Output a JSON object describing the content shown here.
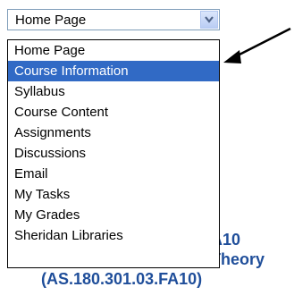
{
  "select": {
    "value": "Home Page",
    "options": [
      {
        "label": "Home Page"
      },
      {
        "label": "Course Information",
        "selected": true
      },
      {
        "label": "Syllabus"
      },
      {
        "label": "Course Content"
      },
      {
        "label": "Assignments"
      },
      {
        "label": "Discussions"
      },
      {
        "label": "Email"
      },
      {
        "label": "My Tasks"
      },
      {
        "label": "My Grades"
      },
      {
        "label": "Sheridan Libraries"
      }
    ],
    "arrow_icon": "chevron-down-icon",
    "highlight_color": "#316ac5"
  },
  "background": {
    "line1": "A10",
    "line2": "Theory",
    "line3": "(AS.180.301.03.FA10)",
    "text_color": "#1f4e9a"
  },
  "annotation": {
    "icon": "pointer-arrow-icon"
  }
}
